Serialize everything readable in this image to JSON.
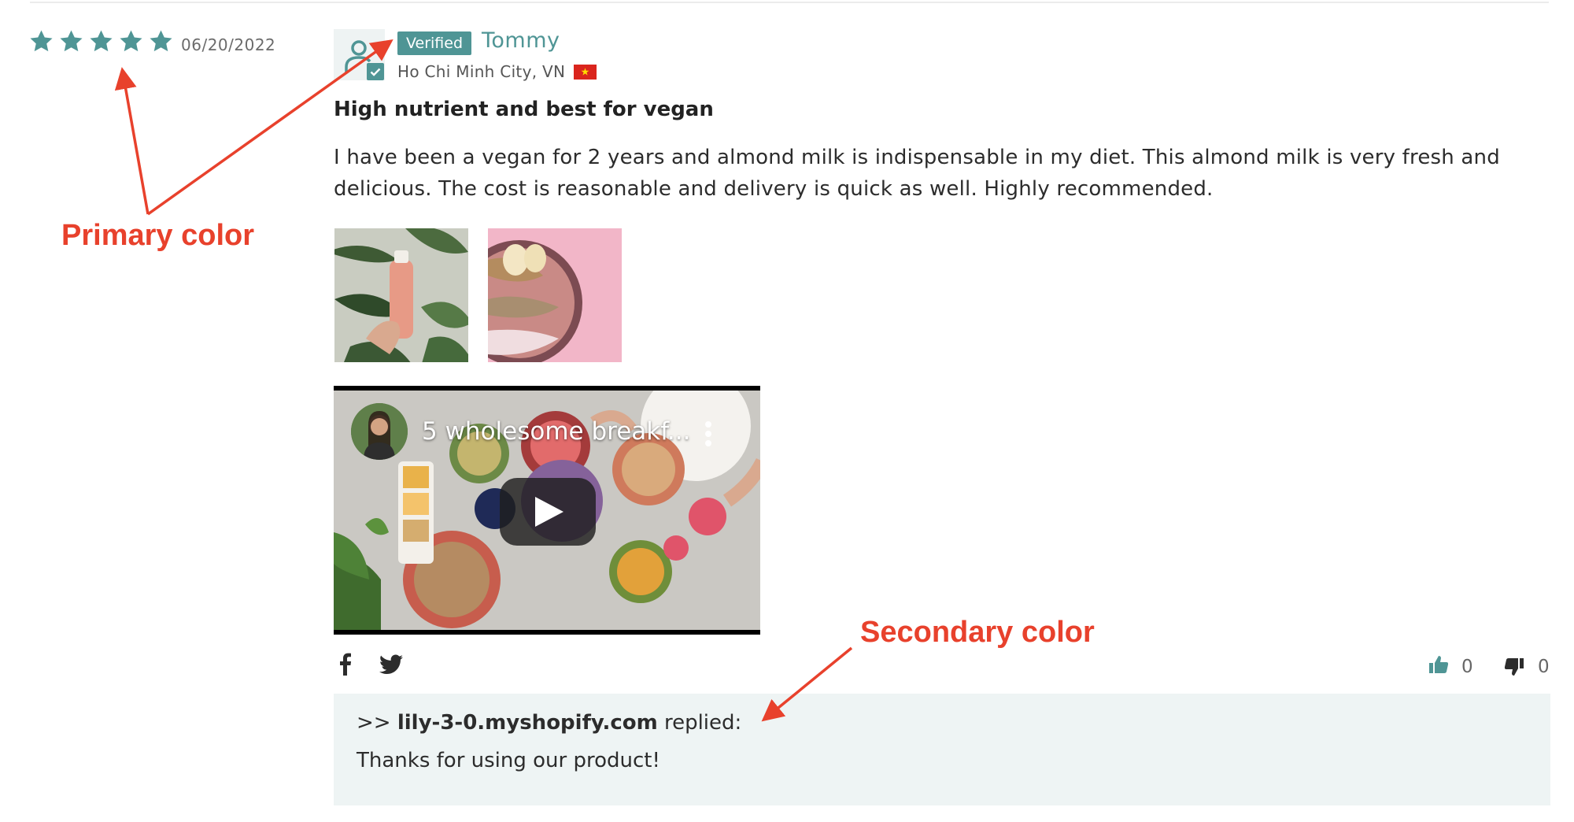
{
  "review": {
    "rating": 5,
    "rating_max": 5,
    "date": "06/20/2022",
    "reviewer": {
      "badge": "Verified",
      "name": "Tommy",
      "location": "Ho Chi Minh City, VN",
      "flag_icon": "vietnam-flag-icon"
    },
    "title": "High nutrient and best for vegan",
    "body": "I have been a vegan for 2 years and almond milk is indispensable in my diet. This almond milk is very fresh and delicious. The cost is reasonable and delivery is quick as well. Highly recommended.",
    "video": {
      "title": "5 wholesome breakf..."
    },
    "social": [
      "facebook-icon",
      "twitter-icon"
    ],
    "votes": {
      "helpful": "0",
      "not_helpful": "0"
    },
    "reply": {
      "prefix": ">>",
      "store": "lily-3-0.myshopify.com",
      "suffix": "replied:",
      "text": "Thanks for using our product!"
    }
  },
  "annotations": {
    "primary": "Primary color",
    "secondary": "Secondary color"
  },
  "colors": {
    "primary": "#4f9595",
    "secondary": "#eef4f4",
    "annotation": "#e8412c"
  }
}
